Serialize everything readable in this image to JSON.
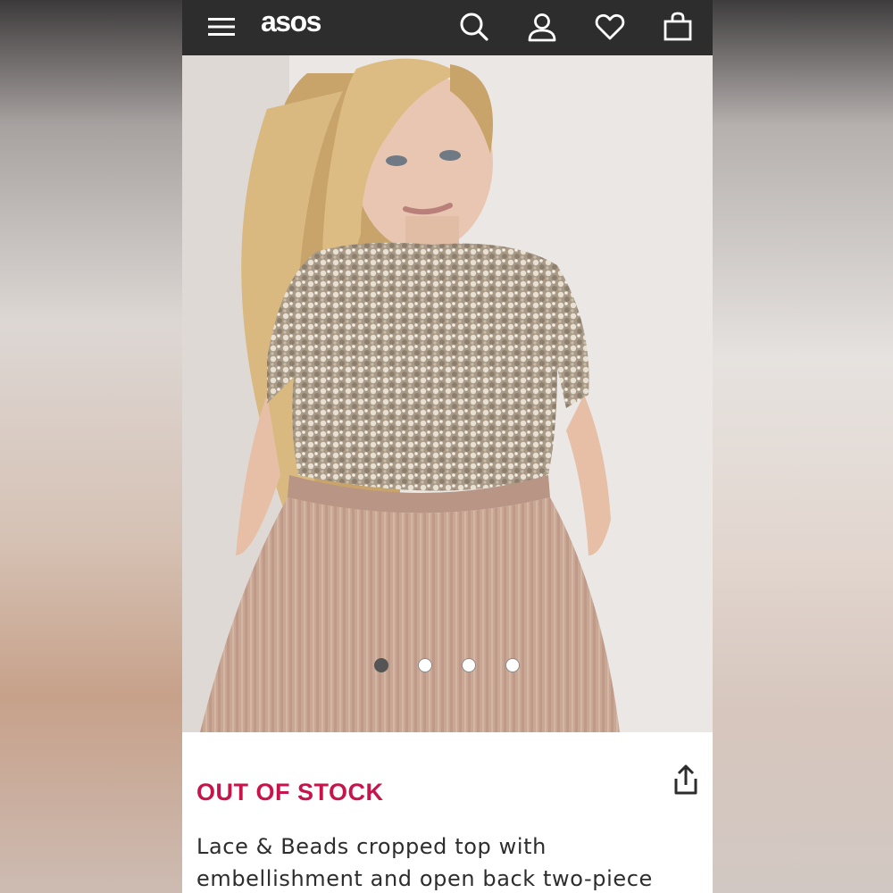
{
  "header": {
    "logo": "asos",
    "icons": [
      "menu-icon",
      "search-icon",
      "account-icon",
      "heart-icon",
      "bag-icon"
    ]
  },
  "gallery": {
    "image_count": 4,
    "active_index": 0
  },
  "product": {
    "status": "OUT OF STOCK",
    "title": "Lace & Beads cropped top with embellishment and open back two-piece"
  },
  "colors": {
    "header_bg": "#2d2d2d",
    "status_color": "#c7154c",
    "skirt": "#c9a795",
    "sequin": "#b9ab98"
  }
}
